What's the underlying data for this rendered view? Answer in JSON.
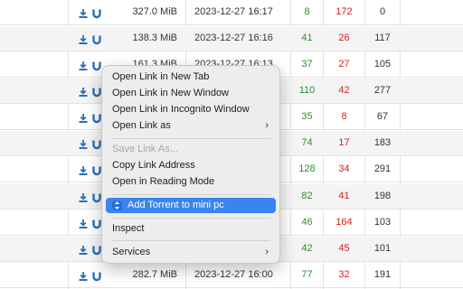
{
  "rows": [
    {
      "size": "327.0 MiB",
      "date": "2023-12-27 16:17",
      "seeders": "8",
      "leechers": "172",
      "completed": "0"
    },
    {
      "size": "138.3 MiB",
      "date": "2023-12-27 16:16",
      "seeders": "41",
      "leechers": "26",
      "completed": "117"
    },
    {
      "size": "161.3 MiB",
      "date": "2023-12-27 16:13",
      "seeders": "37",
      "leechers": "27",
      "completed": "105"
    },
    {
      "size": "",
      "date": "",
      "seeders": "110",
      "leechers": "42",
      "completed": "277"
    },
    {
      "size": "",
      "date": "",
      "seeders": "35",
      "leechers": "8",
      "completed": "67"
    },
    {
      "size": "",
      "date": "",
      "seeders": "74",
      "leechers": "17",
      "completed": "183"
    },
    {
      "size": "",
      "date": "",
      "seeders": "128",
      "leechers": "34",
      "completed": "291"
    },
    {
      "size": "",
      "date": "",
      "seeders": "82",
      "leechers": "41",
      "completed": "198"
    },
    {
      "size": "",
      "date": "",
      "seeders": "46",
      "leechers": "164",
      "completed": "103"
    },
    {
      "size": "",
      "date": "",
      "seeders": "42",
      "leechers": "45",
      "completed": "101"
    },
    {
      "size": "282.7 MiB",
      "date": "2023-12-27 16:00",
      "seeders": "77",
      "leechers": "32",
      "completed": "191"
    }
  ],
  "menu": {
    "open_new_tab": "Open Link in New Tab",
    "open_new_window": "Open Link in New Window",
    "open_incognito": "Open Link in Incognito Window",
    "open_as": "Open Link as",
    "save_link_as": "Save Link As...",
    "copy_link": "Copy Link Address",
    "reading_mode": "Open in Reading Mode",
    "add_torrent": "Add Torrent to mini pc",
    "inspect": "Inspect",
    "services": "Services"
  },
  "icons": [
    "download-icon",
    "magnet-icon",
    "chevron-right-icon",
    "extension-icon"
  ],
  "colors": {
    "seeders": "#2a8f2a",
    "leechers": "#d42020",
    "highlight": "#3a84f2",
    "link_icon": "#2c6fb5"
  }
}
